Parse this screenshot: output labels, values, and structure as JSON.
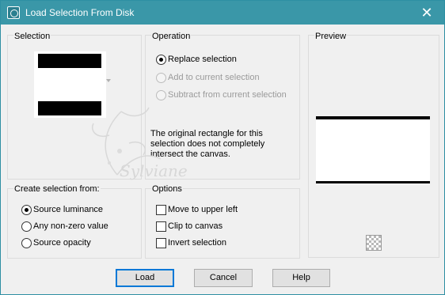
{
  "window": {
    "title": "Load Selection From Disk",
    "close_glyph": "✕",
    "icon": "app-icon"
  },
  "selection": {
    "label": "Selection"
  },
  "operation": {
    "label": "Operation",
    "options": [
      {
        "label": "Replace selection",
        "checked": true,
        "enabled": true
      },
      {
        "label": "Add to current selection",
        "checked": false,
        "enabled": false
      },
      {
        "label": "Subtract from current selection",
        "checked": false,
        "enabled": false
      }
    ],
    "message": "The original rectangle for this selection does not completely intersect the canvas."
  },
  "preview": {
    "label": "Preview",
    "icon": "checkerboard-icon"
  },
  "create_from": {
    "label": "Create selection from:",
    "options": [
      {
        "label": "Source luminance",
        "checked": true
      },
      {
        "label": "Any non-zero value",
        "checked": false
      },
      {
        "label": "Source opacity",
        "checked": false
      }
    ]
  },
  "options": {
    "label": "Options",
    "items": [
      {
        "label": "Move to upper left",
        "checked": false
      },
      {
        "label": "Clip to canvas",
        "checked": false
      },
      {
        "label": "Invert selection",
        "checked": false
      }
    ]
  },
  "buttons": {
    "load": "Load",
    "cancel": "Cancel",
    "help": "Help"
  },
  "watermark": {
    "text": "Sylviane"
  },
  "colors": {
    "titlebar": "#3a97a8",
    "background": "#f0f0f0",
    "default_button_border": "#0078d7"
  }
}
